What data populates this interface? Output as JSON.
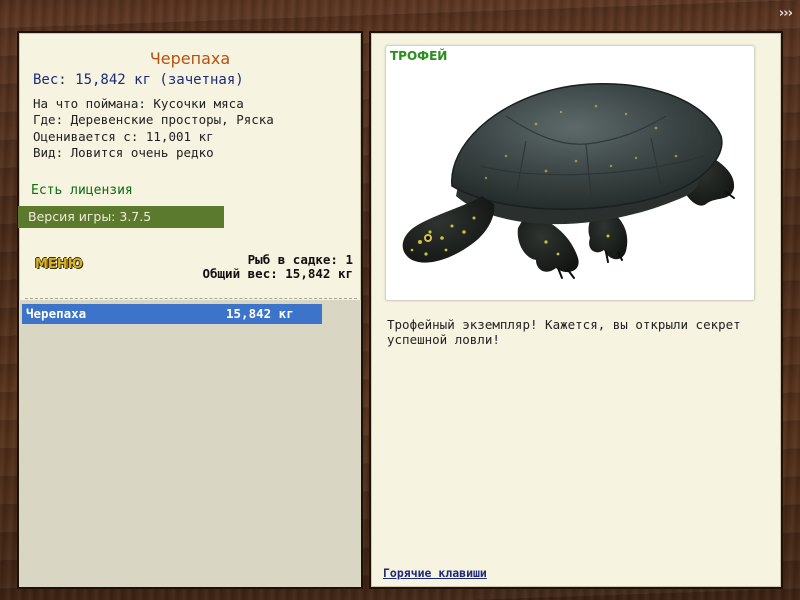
{
  "corner_button": "›››",
  "catch": {
    "title": "Черепаха",
    "weight_line": "Вес: 15,842 кг (зачетная)",
    "details": [
      "На что поймана: Кусочки мяса",
      "Где: Деревенские просторы, Ряска",
      "Оценивается с: 11,001 кг",
      "Вид: Ловится очень редко"
    ]
  },
  "license": "Есть лицензия",
  "version": "Версия игры: 3.7.5",
  "menu_label": "МЕНЮ",
  "cage": {
    "count_line": "Рыб в садке: 1",
    "total_line": "Общий вес: 15,842 кг"
  },
  "cage_list": [
    {
      "name": "Черепаха",
      "weight": "15,842 кг"
    }
  ],
  "trophy": {
    "label": "ТРОФЕЙ",
    "image_icon": "turtle-image",
    "description": "Трофейный экземпляр! Кажется, вы открыли секрет успешной ловли!"
  },
  "hotkeys_link": "Горячие клавиши",
  "colors": {
    "title": "#b5510e",
    "weight": "#1d2a7a",
    "license": "#0e6a14",
    "version_bar": "#5c7a2e",
    "selection": "#3b74c9",
    "trophy_label": "#2e8d22"
  }
}
